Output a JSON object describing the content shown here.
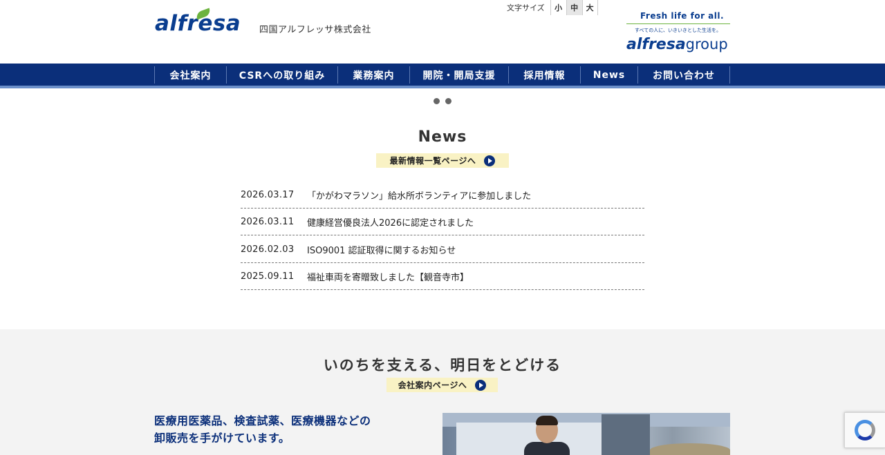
{
  "header": {
    "logo_text": "alfresa",
    "company_name": "四国アルフレッサ株式会社",
    "font_size": {
      "label": "文字サイズ",
      "options": [
        "小",
        "中",
        "大"
      ],
      "selected": "中"
    },
    "group": {
      "tagline": "Fresh life for all.",
      "tagline_sub": "すべての人に、いきいきとした生活を。",
      "logo_main": "alfresa",
      "logo_suffix": "group"
    }
  },
  "nav": {
    "items": [
      "会社案内",
      "CSRへの取り組み",
      "業務案内",
      "開院・開局支援",
      "採用情報",
      "News",
      "お問い合わせ"
    ]
  },
  "slider": {
    "dot_count": 2
  },
  "news": {
    "title": "News",
    "more_link": "最新情報一覧ページへ",
    "items": [
      {
        "date": "2026.03.17",
        "text": "「かがわマラソン」給水所ボランティアに参加しました"
      },
      {
        "date": "2026.03.11",
        "text": "健康経営優良法人2026に認定されました"
      },
      {
        "date": "2026.02.03",
        "text": "ISO9001 認証取得に関するお知らせ"
      },
      {
        "date": "2025.09.11",
        "text": "福祉車両を寄贈致しました【観音寺市】"
      }
    ]
  },
  "company": {
    "title": "いのちを支える、明日をとどける",
    "link": "会社案内ページへ",
    "description_line1": "医療用医薬品、検査試薬、医療機器などの",
    "description_line2": "卸販売を手がけています。"
  },
  "colors": {
    "brand_blue": "#0b2f7a",
    "brand_green": "#6cb33e",
    "pill_bg": "#f9f2c4"
  },
  "icons": {
    "arrow": "circle-arrow-right-icon",
    "recaptcha": "recaptcha-icon"
  }
}
